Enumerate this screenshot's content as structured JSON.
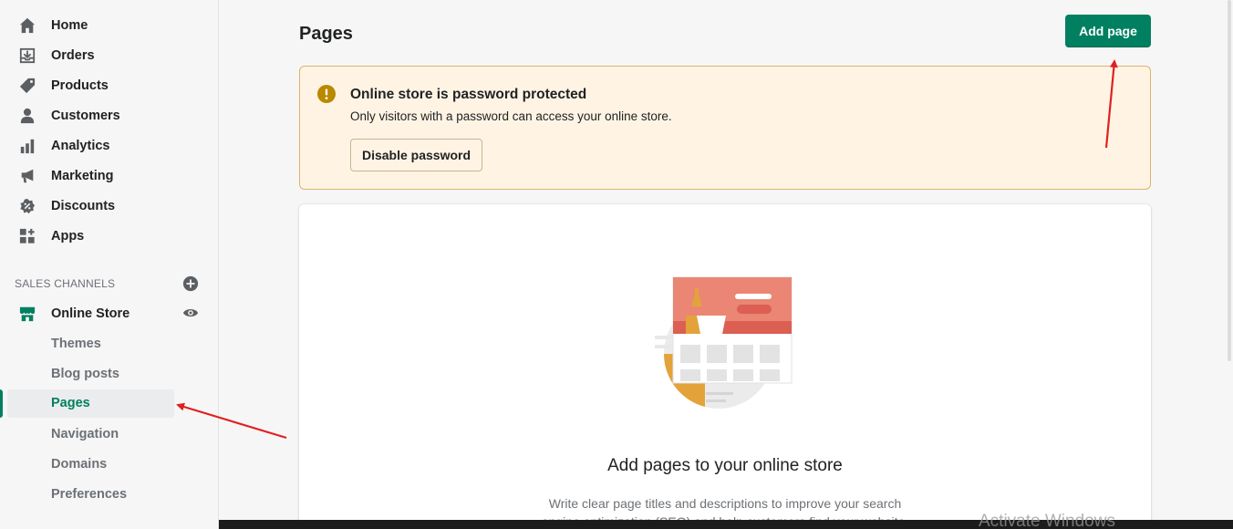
{
  "sidebar": {
    "items": [
      {
        "label": "Home",
        "icon": "home-icon"
      },
      {
        "label": "Orders",
        "icon": "orders-icon"
      },
      {
        "label": "Products",
        "icon": "tag-icon"
      },
      {
        "label": "Customers",
        "icon": "person-icon"
      },
      {
        "label": "Analytics",
        "icon": "bar-chart-icon"
      },
      {
        "label": "Marketing",
        "icon": "megaphone-icon"
      },
      {
        "label": "Discounts",
        "icon": "discount-icon"
      },
      {
        "label": "Apps",
        "icon": "apps-icon"
      }
    ],
    "sales_channels_title": "SALES CHANNELS",
    "online_store": "Online Store",
    "sub_items": [
      "Themes",
      "Blog posts",
      "Pages",
      "Navigation",
      "Domains",
      "Preferences"
    ],
    "active_sub_item": "Pages"
  },
  "header": {
    "title": "Pages",
    "add_button": "Add page"
  },
  "banner": {
    "title": "Online store is password protected",
    "text": "Only visitors with a password can access your online store.",
    "button": "Disable password"
  },
  "empty_state": {
    "title": "Add pages to your online store",
    "text": "Write clear page titles and descriptions to improve your search engine optimization (SEO) and help customers find your website."
  },
  "watermark": "Activate Windows",
  "colors": {
    "brand": "#008060",
    "warning_bg": "#fff4e4",
    "warning_border": "#e0b36b",
    "warning_icon": "#b98900",
    "annotation_arrow": "#e02020"
  }
}
